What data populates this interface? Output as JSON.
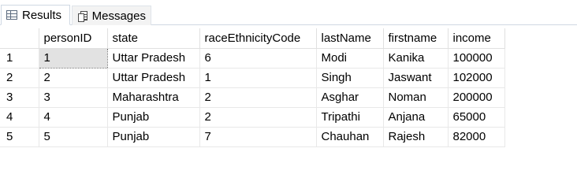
{
  "tabs": {
    "results_label": "Results",
    "messages_label": "Messages"
  },
  "grid": {
    "columns": [
      "",
      "personID",
      "state",
      "raceEthnicityCode",
      "lastName",
      "firstname",
      "income"
    ],
    "rows": [
      {
        "num": "1",
        "personID": "1",
        "state": "Uttar Pradesh",
        "raceEthnicityCode": "6",
        "lastName": "Modi",
        "firstname": "Kanika",
        "income": "100000"
      },
      {
        "num": "2",
        "personID": "2",
        "state": "Uttar Pradesh",
        "raceEthnicityCode": "1",
        "lastName": "Singh",
        "firstname": "Jaswant",
        "income": "102000"
      },
      {
        "num": "3",
        "personID": "3",
        "state": "Maharashtra",
        "raceEthnicityCode": "2",
        "lastName": "Asghar",
        "firstname": "Noman",
        "income": "200000"
      },
      {
        "num": "4",
        "personID": "4",
        "state": "Punjab",
        "raceEthnicityCode": "2",
        "lastName": "Tripathi",
        "firstname": "Anjana",
        "income": "65000"
      },
      {
        "num": "5",
        "personID": "5",
        "state": "Punjab",
        "raceEthnicityCode": "7",
        "lastName": "Chauhan",
        "firstname": "Rajesh",
        "income": "82000"
      }
    ]
  },
  "colors": {
    "selected_cell_bg": "#e2e2e2",
    "grid_line": "#e8e8e8",
    "tab_border": "#cfd8e3"
  },
  "icons": {
    "results": "grid-icon",
    "messages": "messages-icon"
  }
}
